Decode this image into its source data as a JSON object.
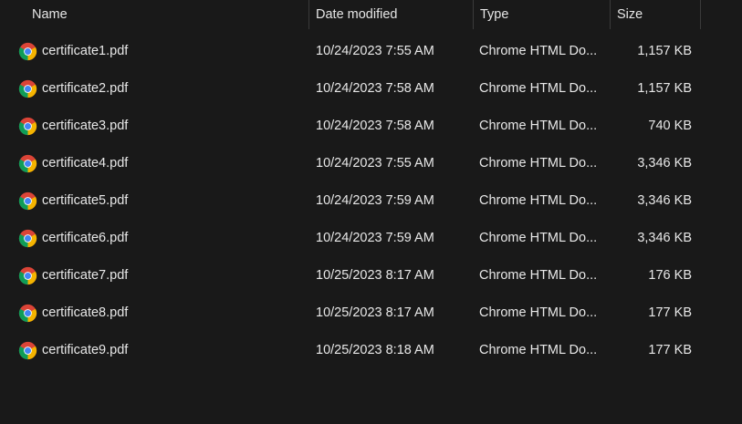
{
  "columns": {
    "name": "Name",
    "date": "Date modified",
    "type": "Type",
    "size": "Size"
  },
  "sort_icon": "chevron-up-icon",
  "file_icon": "chrome-icon",
  "files": [
    {
      "name": "certificate1.pdf",
      "date": "10/24/2023 7:55 AM",
      "type": "Chrome HTML Do...",
      "size": "1,157 KB"
    },
    {
      "name": "certificate2.pdf",
      "date": "10/24/2023 7:58 AM",
      "type": "Chrome HTML Do...",
      "size": "1,157 KB"
    },
    {
      "name": "certificate3.pdf",
      "date": "10/24/2023 7:58 AM",
      "type": "Chrome HTML Do...",
      "size": "740 KB"
    },
    {
      "name": "certificate4.pdf",
      "date": "10/24/2023 7:55 AM",
      "type": "Chrome HTML Do...",
      "size": "3,346 KB"
    },
    {
      "name": "certificate5.pdf",
      "date": "10/24/2023 7:59 AM",
      "type": "Chrome HTML Do...",
      "size": "3,346 KB"
    },
    {
      "name": "certificate6.pdf",
      "date": "10/24/2023 7:59 AM",
      "type": "Chrome HTML Do...",
      "size": "3,346 KB"
    },
    {
      "name": "certificate7.pdf",
      "date": "10/25/2023 8:17 AM",
      "type": "Chrome HTML Do...",
      "size": "176 KB"
    },
    {
      "name": "certificate8.pdf",
      "date": "10/25/2023 8:17 AM",
      "type": "Chrome HTML Do...",
      "size": "177 KB"
    },
    {
      "name": "certificate9.pdf",
      "date": "10/25/2023 8:18 AM",
      "type": "Chrome HTML Do...",
      "size": "177 KB"
    }
  ]
}
